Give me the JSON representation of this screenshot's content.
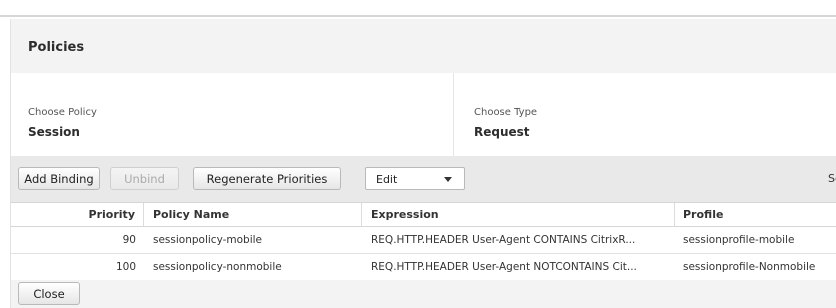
{
  "section": {
    "title": "Policies"
  },
  "choose": {
    "policy_label": "Choose Policy",
    "policy_value": "Session",
    "type_label": "Choose Type",
    "type_value": "Request"
  },
  "toolbar": {
    "add_binding": "Add Binding",
    "unbind": "Unbind",
    "regenerate": "Regenerate Priorities",
    "action_select": "Edit",
    "search_truncated": "Se"
  },
  "table": {
    "headers": {
      "priority": "Priority",
      "policy_name": "Policy Name",
      "expression": "Expression",
      "profile": "Profile"
    },
    "rows": [
      {
        "priority": "90",
        "policy_name": "sessionpolicy-mobile",
        "expression": "REQ.HTTP.HEADER User-Agent CONTAINS CitrixR...",
        "profile": "sessionprofile-mobile"
      },
      {
        "priority": "100",
        "policy_name": "sessionpolicy-nonmobile",
        "expression": "REQ.HTTP.HEADER User-Agent NOTCONTAINS Cit...",
        "profile": "sessionprofile-Nonmobile"
      }
    ]
  },
  "footer": {
    "close": "Close"
  }
}
